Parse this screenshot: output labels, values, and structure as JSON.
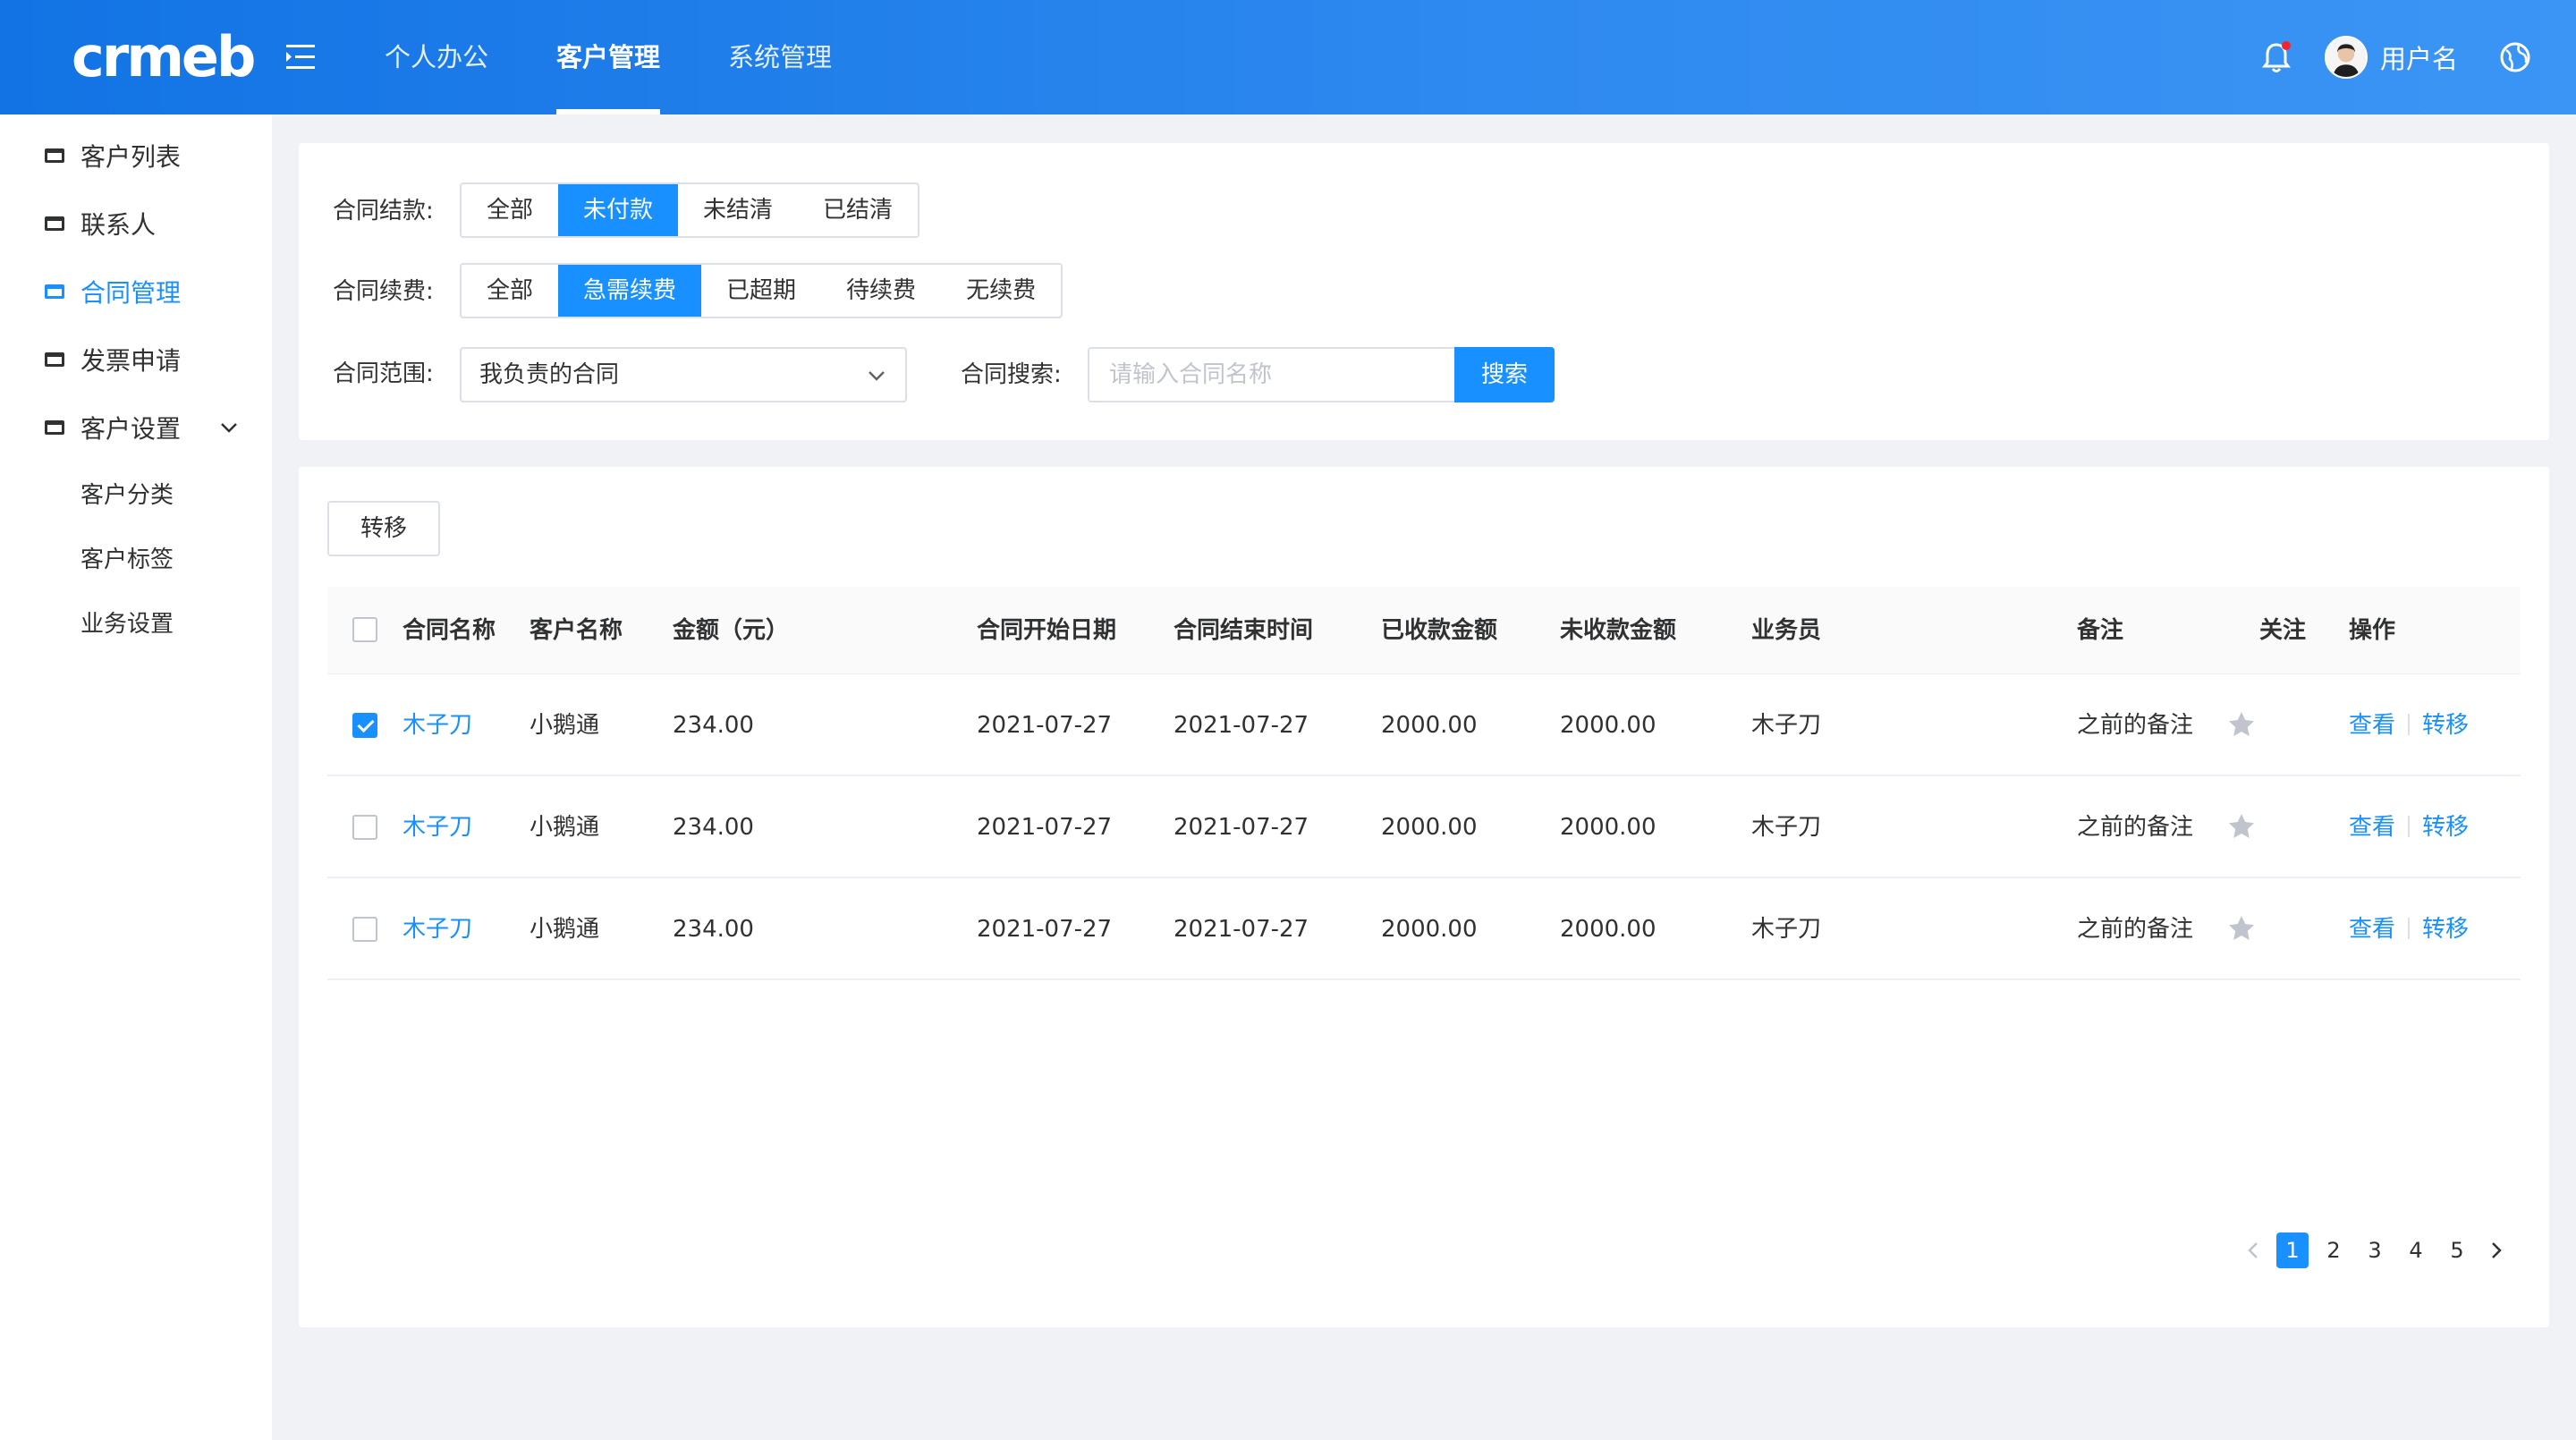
{
  "header": {
    "logo": "crmeb",
    "nav": [
      "个人办公",
      "客户管理",
      "系统管理"
    ],
    "active_nav": 1,
    "username": "用户名"
  },
  "sidebar": {
    "items": [
      {
        "label": "客户列表",
        "active": false
      },
      {
        "label": "联系人",
        "active": false
      },
      {
        "label": "合同管理",
        "active": true
      },
      {
        "label": "发票申请",
        "active": false
      },
      {
        "label": "客户设置",
        "active": false
      }
    ],
    "sub_items": [
      "客户分类",
      "客户标签",
      "业务设置"
    ]
  },
  "filters": {
    "payment": {
      "label": "合同结款:",
      "options": [
        "全部",
        "未付款",
        "未结清",
        "已结清"
      ],
      "active": 1
    },
    "renewal": {
      "label": "合同续费:",
      "options": [
        "全部",
        "急需续费",
        "已超期",
        "待续费",
        "无续费"
      ],
      "active": 1
    },
    "scope": {
      "label": "合同范围:",
      "value": "我负责的合同"
    },
    "search": {
      "label": "合同搜索:",
      "placeholder": "请输入合同名称",
      "button": "搜索"
    }
  },
  "table": {
    "transfer_button": "转移",
    "columns": [
      "合同名称",
      "客户名称",
      "金额（元）",
      "合同开始日期",
      "合同结束时间",
      "已收款金额",
      "未收款金额",
      "业务员",
      "备注",
      "关注",
      "操作"
    ],
    "rows": [
      {
        "checked": true,
        "name": "木子刀",
        "customer": "小鹅通",
        "amount": "234.00",
        "start": "2021-07-27",
        "end": "2021-07-27",
        "received": "2000.00",
        "unreceived": "2000.00",
        "salesman": "木子刀",
        "remark": "之前的备注",
        "op_view": "查看",
        "op_transfer": "转移"
      },
      {
        "checked": false,
        "name": "木子刀",
        "customer": "小鹅通",
        "amount": "234.00",
        "start": "2021-07-27",
        "end": "2021-07-27",
        "received": "2000.00",
        "unreceived": "2000.00",
        "salesman": "木子刀",
        "remark": "之前的备注",
        "op_view": "查看",
        "op_transfer": "转移"
      },
      {
        "checked": false,
        "name": "木子刀",
        "customer": "小鹅通",
        "amount": "234.00",
        "start": "2021-07-27",
        "end": "2021-07-27",
        "received": "2000.00",
        "unreceived": "2000.00",
        "salesman": "木子刀",
        "remark": "之前的备注",
        "op_view": "查看",
        "op_transfer": "转移"
      }
    ]
  },
  "pagination": {
    "pages": [
      "1",
      "2",
      "3",
      "4",
      "5"
    ],
    "current": 0
  },
  "colors": {
    "primary": "#1890ff",
    "header_start": "#1273e4",
    "header_end": "#3b95f5",
    "star": "#c0c4cc"
  },
  "icons": [
    "menu-fold-icon",
    "bell-icon",
    "globe-icon",
    "chevron-down-icon",
    "star-icon",
    "chevron-left-icon",
    "chevron-right-icon"
  ]
}
